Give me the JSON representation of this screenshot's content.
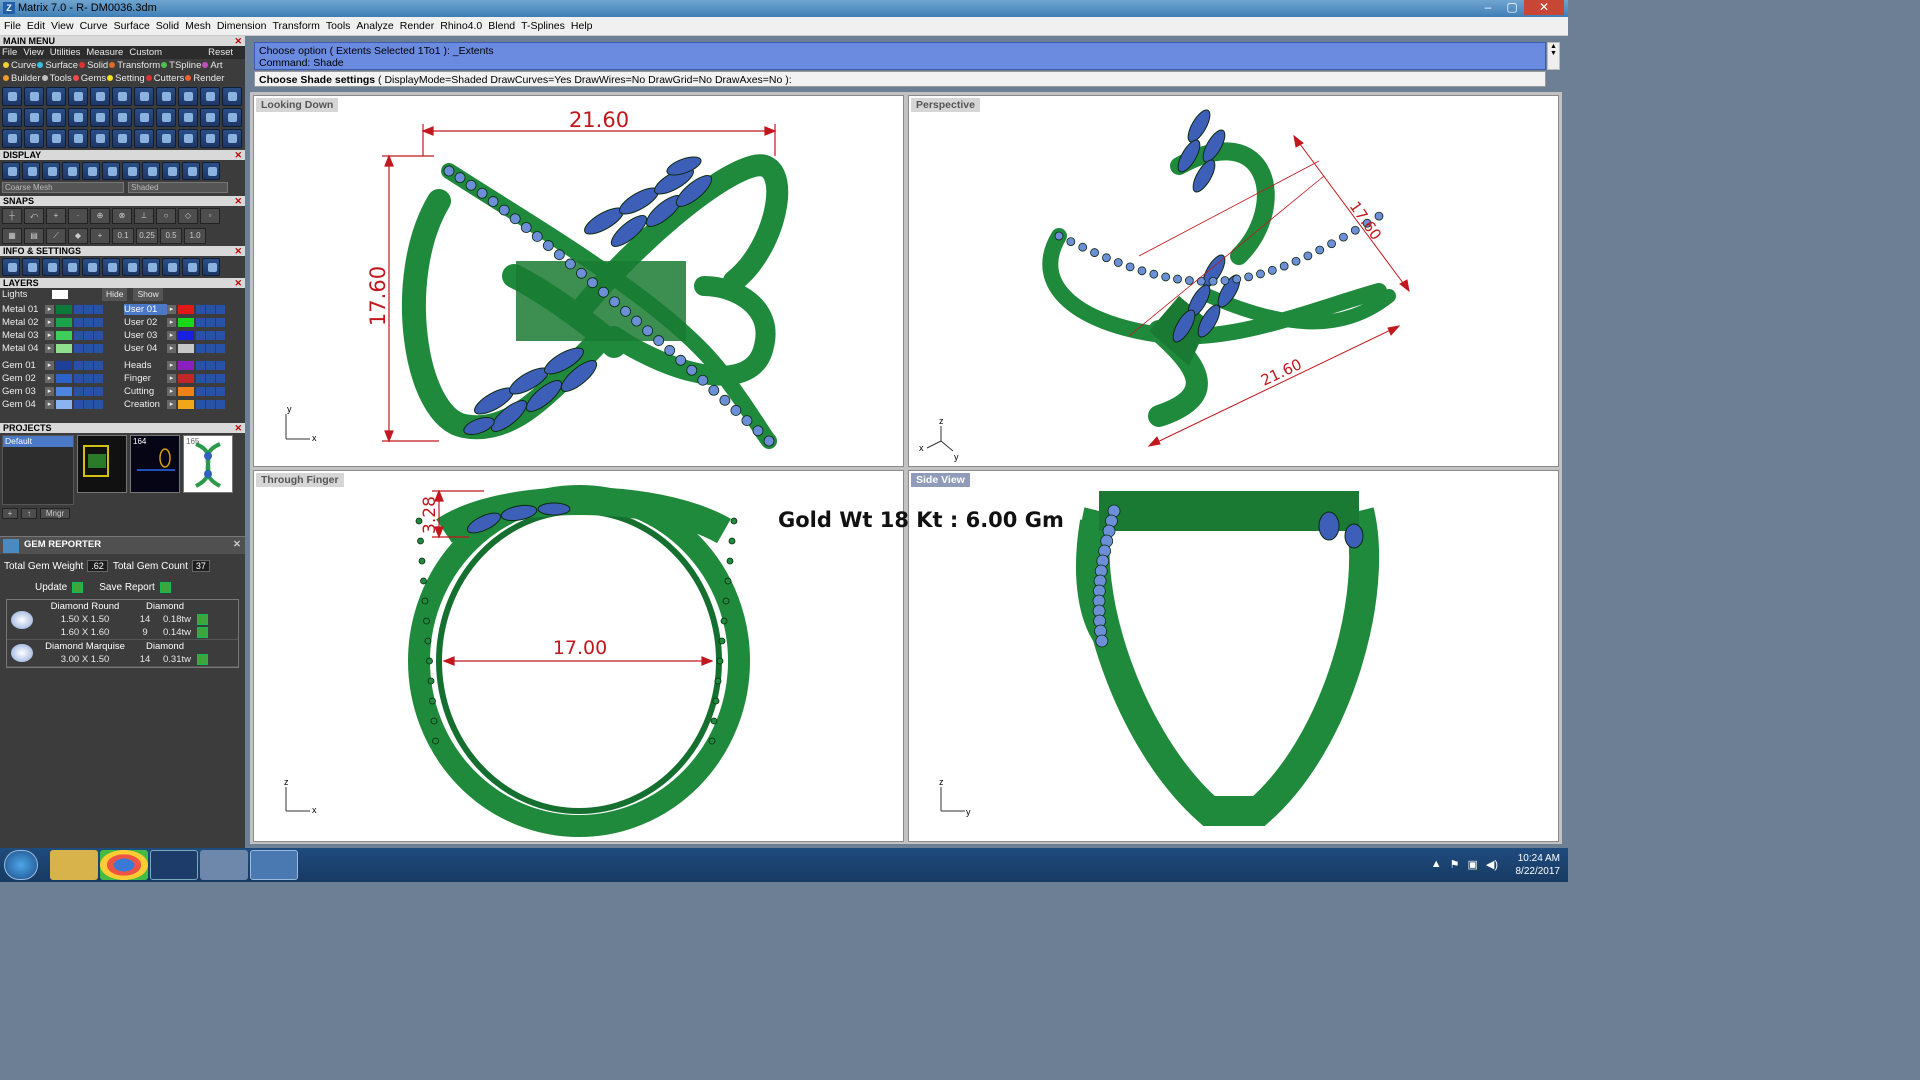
{
  "window": {
    "title": "Matrix 7.0 - R- DM0036.3dm",
    "controls": [
      "–",
      "▢",
      "✕"
    ]
  },
  "menu": [
    "File",
    "Edit",
    "View",
    "Curve",
    "Surface",
    "Solid",
    "Mesh",
    "Dimension",
    "Transform",
    "Tools",
    "Analyze",
    "Render",
    "Rhino4.0",
    "Blend",
    "T-Splines",
    "Help"
  ],
  "main_menu": {
    "title": "MAIN MENU",
    "row1": [
      "File",
      "View",
      "Utilities",
      "Measure",
      "Custom"
    ],
    "reset": "Reset",
    "row2": [
      {
        "label": "Curve",
        "color": "#f2d02b"
      },
      {
        "label": "Surface",
        "color": "#35c0e0"
      },
      {
        "label": "Solid",
        "color": "#e03030"
      },
      {
        "label": "Transform",
        "color": "#e06a1f"
      },
      {
        "label": "TSpline",
        "color": "#4fc04f"
      },
      {
        "label": "Art",
        "color": "#c04fc0"
      }
    ],
    "row3": [
      {
        "label": "Builder",
        "color": "#f29a2b"
      },
      {
        "label": "Tools",
        "color": "#c0c0c0"
      },
      {
        "label": "Gems",
        "color": "#f24a4a"
      },
      {
        "label": "Setting",
        "color": "#f2e02b"
      },
      {
        "label": "Cutters",
        "color": "#e03030"
      },
      {
        "label": "Render",
        "color": "#f06030"
      }
    ]
  },
  "display": {
    "title": "DISPLAY",
    "mesh": "Coarse Mesh",
    "mode": "Shaded"
  },
  "snaps": {
    "title": "SNAPS",
    "values": [
      "0.1",
      "0.25",
      "0.5",
      "1.0"
    ]
  },
  "info": {
    "title": "INFO & SETTINGS"
  },
  "layers": {
    "title": "LAYERS",
    "lights": "Lights",
    "hide": "Hide",
    "show": "Show",
    "left": [
      {
        "name": "Metal 01",
        "color": "#0c7a3a"
      },
      {
        "name": "Metal 02",
        "color": "#1aa24a"
      },
      {
        "name": "Metal 03",
        "color": "#3ccd5a"
      },
      {
        "name": "Metal 04",
        "color": "#8ee08e"
      },
      {
        "name": "Gem 01",
        "color": "#1e3f9a"
      },
      {
        "name": "Gem 02",
        "color": "#2d62c8"
      },
      {
        "name": "Gem 03",
        "color": "#4d86e0"
      },
      {
        "name": "Gem 04",
        "color": "#8ab4f0"
      }
    ],
    "right": [
      {
        "name": "User 01",
        "color": "#e01818",
        "selected": true
      },
      {
        "name": "User 02",
        "color": "#18d818"
      },
      {
        "name": "User 03",
        "color": "#1820e0"
      },
      {
        "name": "User 04",
        "color": "#c8c8c8"
      },
      {
        "name": "Heads",
        "color": "#8a1fc0"
      },
      {
        "name": "Finger",
        "color": "#c02828"
      },
      {
        "name": "Cutting",
        "color": "#f08018"
      },
      {
        "name": "Creation",
        "color": "#f0a818"
      }
    ]
  },
  "projects": {
    "title": "PROJECTS",
    "default": "Default",
    "thumb2": "164",
    "thumb3": "165",
    "mngr": "Mngr"
  },
  "gem_reporter": {
    "title": "GEM REPORTER",
    "total_weight_label": "Total Gem Weight",
    "total_weight": ".62",
    "total_count_label": "Total Gem Count",
    "total_count": "37",
    "update": "Update",
    "save": "Save Report",
    "groups": [
      {
        "type": "Diamond Round",
        "material": "Diamond",
        "rows": [
          [
            "1.50 X 1.50",
            "14",
            "0.18tw"
          ],
          [
            "1.60 X 1.60",
            "9",
            "0.14tw"
          ]
        ]
      },
      {
        "type": "Diamond Marquise",
        "material": "Diamond",
        "rows": [
          [
            "3.00 X 1.50",
            "14",
            "0.31tw"
          ]
        ]
      }
    ]
  },
  "command": {
    "history1": "Choose option ( Extents  Selected  1To1 ): _Extents",
    "history2": "Command: Shade",
    "prompt_label": "Choose Shade settings",
    "prompt_rest": "( DisplayMode=Shaded  DrawCurves=Yes  DrawWires=No  DrawGrid=No  DrawAxes=No ):"
  },
  "viewports": {
    "top": {
      "title": "Looking Down",
      "dim_width": "21.60",
      "dim_height": "17.60",
      "ax_x": "x",
      "ax_y": "y"
    },
    "persp": {
      "title": "Perspective",
      "dim_a": "17.60",
      "dim_b": "21.60",
      "ax_x": "x",
      "ax_y": "y",
      "ax_z": "z"
    },
    "front": {
      "title": "Through Finger",
      "dim_h": "3.28",
      "dim_d": "17.00",
      "ax_x": "x",
      "ax_z": "z"
    },
    "side": {
      "title": "Side View",
      "ax_y": "y",
      "ax_z": "z"
    }
  },
  "gold_weight": "Gold Wt 18 Kt : 6.00 Gm",
  "taskbar": {
    "time": "10:24 AM",
    "date": "8/22/2017"
  },
  "colors": {
    "metal": "#1f8a3c",
    "gem": "#3d5fb8",
    "dimension": "#c0181c"
  }
}
